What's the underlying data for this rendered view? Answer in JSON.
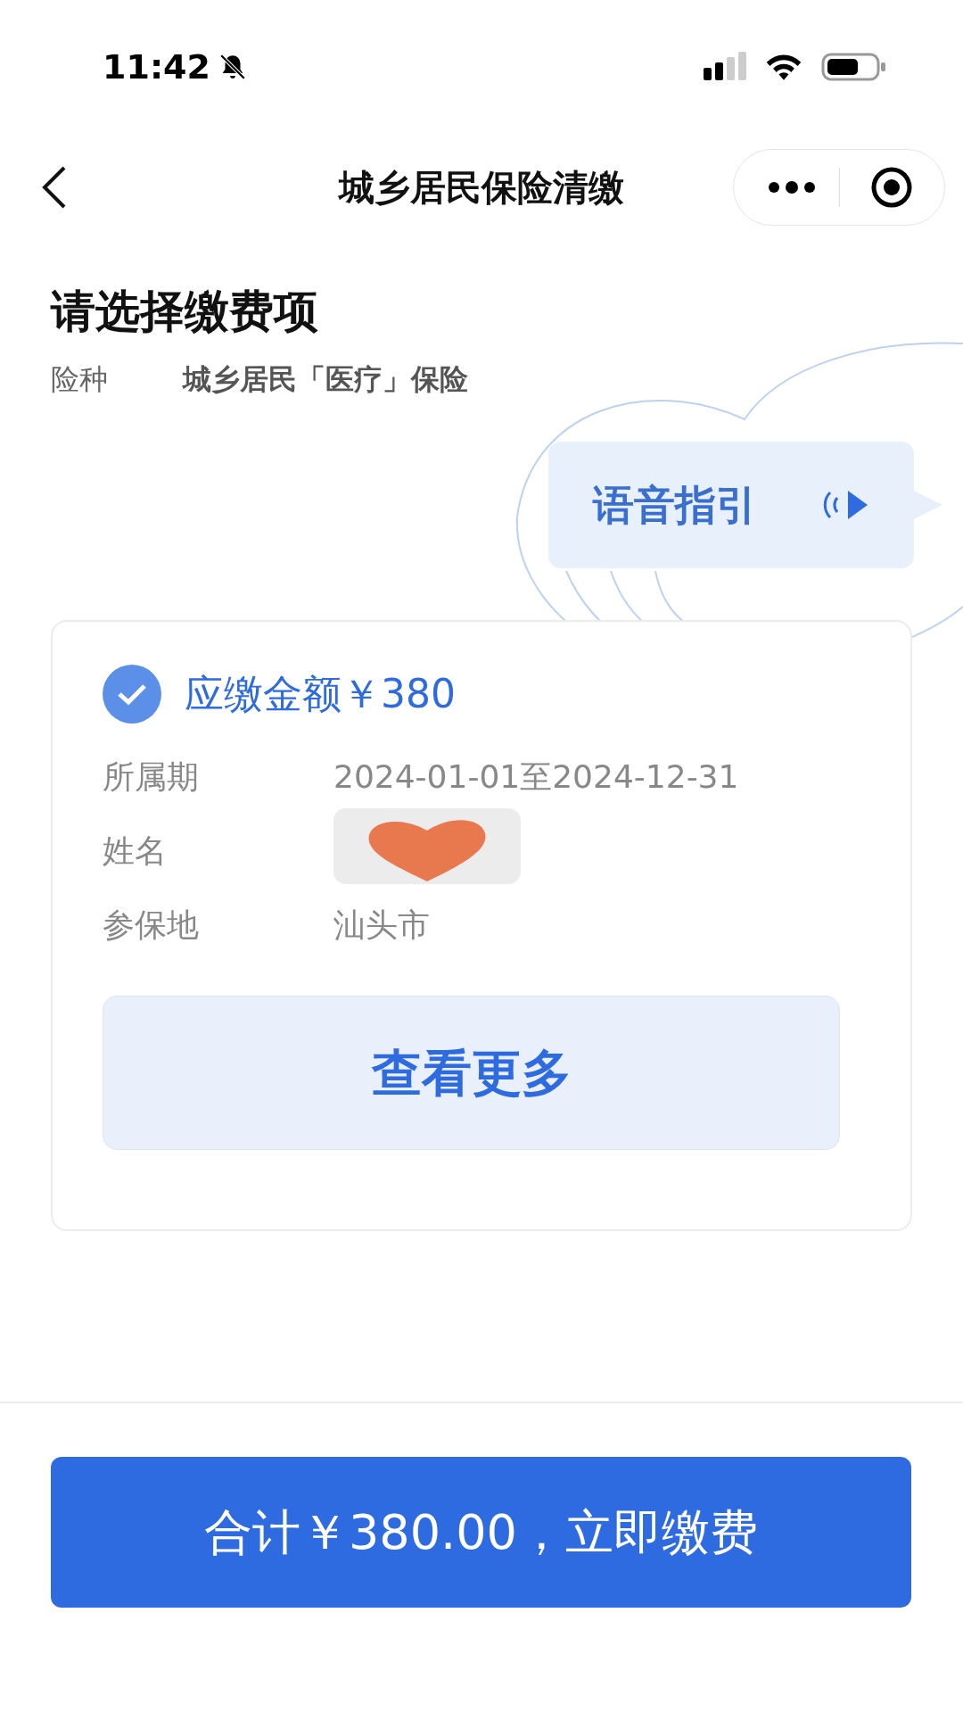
{
  "status_bar": {
    "time": "11:42"
  },
  "nav": {
    "title": "城乡居民保险清缴"
  },
  "heading": "请选择缴费项",
  "insurance": {
    "label": "险种",
    "value": "城乡居民「医疗」保险"
  },
  "voice_guide": {
    "label": "语音指引"
  },
  "item": {
    "checked": true,
    "amount": "应缴金额￥380",
    "rows": [
      {
        "kind": "text",
        "label": "所属期",
        "value": "2024-01-01至2024-12-31"
      },
      {
        "kind": "redacted",
        "label": "姓名"
      },
      {
        "kind": "text",
        "label": "参保地",
        "value": "汕头市"
      }
    ],
    "more_button": "查看更多"
  },
  "pay_button": "合计￥380.00，立即缴费"
}
